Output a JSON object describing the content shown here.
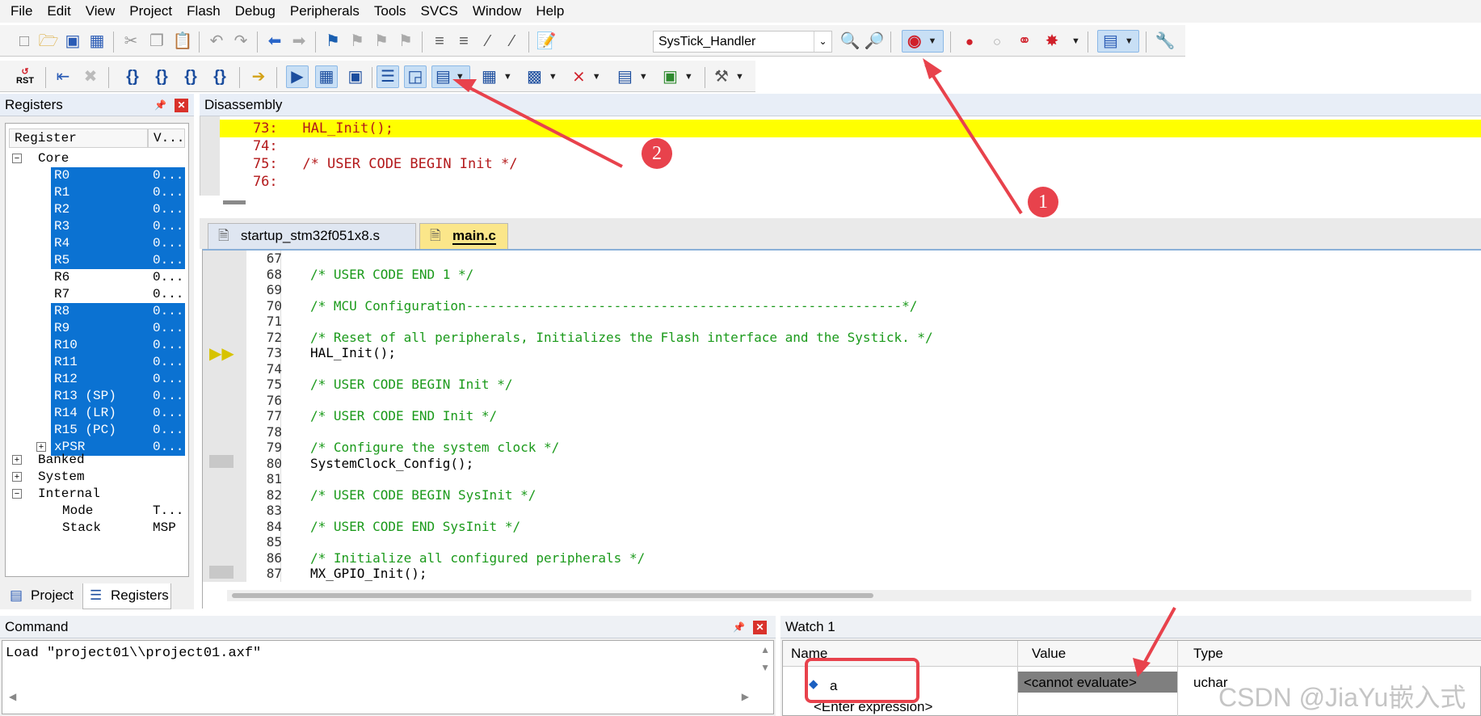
{
  "menu": [
    "File",
    "Edit",
    "View",
    "Project",
    "Flash",
    "Debug",
    "Peripherals",
    "Tools",
    "SVCS",
    "Window",
    "Help"
  ],
  "toolbar": {
    "function_combo": "SysTick_Handler",
    "rst_label": "RST"
  },
  "registers": {
    "title": "Registers",
    "col_register": "Register",
    "col_value": "V...",
    "core_label": "Core",
    "core_items": [
      {
        "name": "R0",
        "value": "0..."
      },
      {
        "name": "R1",
        "value": "0..."
      },
      {
        "name": "R2",
        "value": "0..."
      },
      {
        "name": "R3",
        "value": "0..."
      },
      {
        "name": "R4",
        "value": "0..."
      },
      {
        "name": "R5",
        "value": "0..."
      },
      {
        "name": "R6",
        "value": "0..."
      },
      {
        "name": "R7",
        "value": "0..."
      },
      {
        "name": "R8",
        "value": "0..."
      },
      {
        "name": "R9",
        "value": "0..."
      },
      {
        "name": "R10",
        "value": "0..."
      },
      {
        "name": "R11",
        "value": "0..."
      },
      {
        "name": "R12",
        "value": "0..."
      },
      {
        "name": "R13 (SP)",
        "value": "0..."
      },
      {
        "name": "R14 (LR)",
        "value": "0..."
      },
      {
        "name": "R15 (PC)",
        "value": "0..."
      },
      {
        "name": "xPSR",
        "value": "0..."
      }
    ],
    "groups": [
      "Banked",
      "System",
      "Internal"
    ],
    "internal_items": [
      {
        "name": "Mode",
        "value": "T..."
      },
      {
        "name": "Stack",
        "value": "MSP"
      }
    ],
    "tab_project": "Project",
    "tab_registers": "Registers"
  },
  "disassembly": {
    "title": "Disassembly",
    "lines": [
      "    73:   HAL_Init();",
      "    74: ",
      "    75:   /* USER CODE BEGIN Init */",
      "    76: "
    ]
  },
  "editor": {
    "tabs": [
      "startup_stm32f051x8.s",
      "main.c"
    ],
    "lines": [
      {
        "n": "67",
        "t": ""
      },
      {
        "n": "68",
        "t": "/* USER CODE END 1 */"
      },
      {
        "n": "69",
        "t": ""
      },
      {
        "n": "70",
        "t": "/* MCU Configuration--------------------------------------------------------*/"
      },
      {
        "n": "71",
        "t": ""
      },
      {
        "n": "72",
        "t": "/* Reset of all peripherals, Initializes the Flash interface and the Systick. */"
      },
      {
        "n": "73",
        "t": "HAL_Init();"
      },
      {
        "n": "74",
        "t": ""
      },
      {
        "n": "75",
        "t": "/* USER CODE BEGIN Init */"
      },
      {
        "n": "76",
        "t": ""
      },
      {
        "n": "77",
        "t": "/* USER CODE END Init */"
      },
      {
        "n": "78",
        "t": ""
      },
      {
        "n": "79",
        "t": "/* Configure the system clock */"
      },
      {
        "n": "80",
        "t": "SystemClock_Config();"
      },
      {
        "n": "81",
        "t": ""
      },
      {
        "n": "82",
        "t": "/* USER CODE BEGIN SysInit */"
      },
      {
        "n": "83",
        "t": ""
      },
      {
        "n": "84",
        "t": "/* USER CODE END SysInit */"
      },
      {
        "n": "85",
        "t": ""
      },
      {
        "n": "86",
        "t": "/* Initialize all configured peripherals */"
      },
      {
        "n": "87",
        "t": "MX_GPIO_Init();"
      }
    ]
  },
  "command": {
    "title": "Command",
    "text": "Load \"project01\\\\project01.axf\""
  },
  "watch": {
    "title": "Watch 1",
    "col_name": "Name",
    "col_value": "Value",
    "col_type": "Type",
    "row_name": "a",
    "row_value": "<cannot evaluate>",
    "row_type": "uchar",
    "enter_expr": "<Enter expression>"
  },
  "annotations": {
    "badge1": "1",
    "badge2": "2"
  },
  "watermark": "CSDN @JiaYu嵌入式",
  "colors": {
    "accent": "#0b72d2",
    "current_line": "#ffff00",
    "annotation": "#e8424c",
    "comment": "#1b9a1b",
    "disasm": "#b3181a"
  }
}
